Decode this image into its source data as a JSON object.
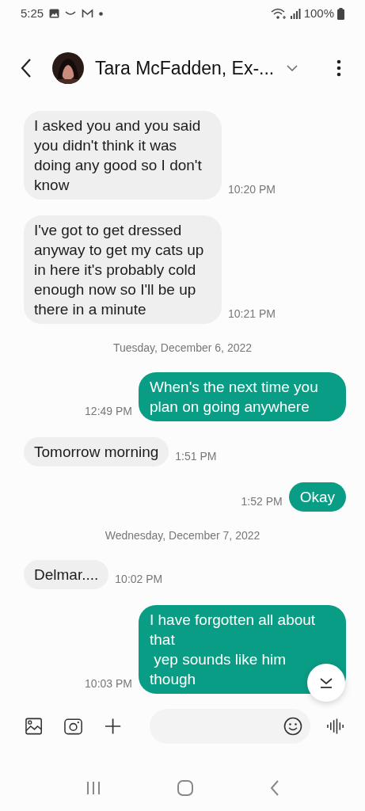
{
  "status_bar": {
    "time": "5:25",
    "battery": "100%"
  },
  "header": {
    "title": "Tara McFadden, Ex-..."
  },
  "messages": [
    {
      "kind": "incoming",
      "text": "I asked you and you said you didn't think it was doing any good so I don't know",
      "time": "10:20 PM"
    },
    {
      "kind": "incoming",
      "text": "I've got to get dressed anyway to get my cats up in here it's probably cold enough now so I'll be up there in a minute",
      "time": "10:21 PM"
    },
    {
      "kind": "date",
      "text": "Tuesday, December 6, 2022"
    },
    {
      "kind": "outgoing",
      "text": "When's the next time you plan on going anywhere",
      "time": "12:49 PM"
    },
    {
      "kind": "incoming",
      "text": "Tomorrow morning",
      "time": "1:51 PM"
    },
    {
      "kind": "outgoing",
      "text": "Okay",
      "time": "1:52 PM"
    },
    {
      "kind": "date",
      "text": "Wednesday, December 7, 2022"
    },
    {
      "kind": "incoming",
      "text": "Delmar....",
      "time": "10:02 PM"
    },
    {
      "kind": "outgoing",
      "text": "I have forgotten all about that\n yep sounds like him though",
      "time": "10:03 PM"
    }
  ]
}
